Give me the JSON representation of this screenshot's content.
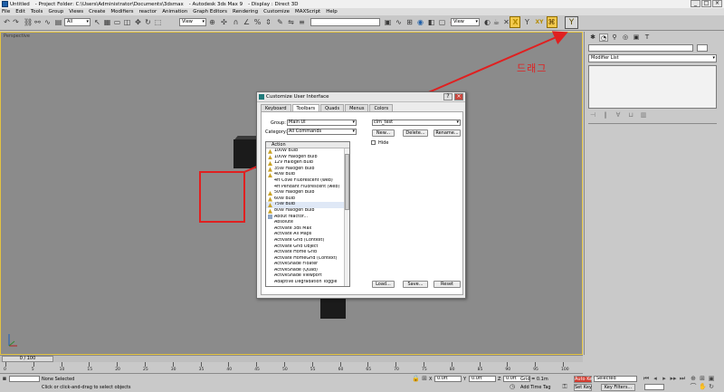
{
  "titlebar": {
    "segments": [
      "Untitled",
      "- Project Folder: C:\\Users\\Administrator\\Documents\\3dsmax",
      "- Autodesk 3ds Max 9",
      "- Display : Direct 3D"
    ],
    "win_buttons": [
      "_",
      "□",
      "×"
    ]
  },
  "menubar": [
    "File",
    "Edit",
    "Tools",
    "Group",
    "Views",
    "Create",
    "Modifiers",
    "reactor",
    "Animation",
    "Graph Editors",
    "Rendering",
    "Customize",
    "MAXScript",
    "Help"
  ],
  "toolbar": {
    "filter": "All",
    "ref_coord_1": "View",
    "ref_coord_2": "View",
    "axis_labels": [
      "X",
      "Y",
      "XY"
    ]
  },
  "viewport": {
    "label": "Perspective"
  },
  "annotation": {
    "label": "드래그",
    "color": "#e02020"
  },
  "cmdpanel": {
    "modifier_list": "Modifier List"
  },
  "dialog": {
    "title": "Customize User Interface",
    "tabs": [
      "Keyboard",
      "Toolbars",
      "Quads",
      "Menus",
      "Colors"
    ],
    "active_tab": "Toolbars",
    "group_label": "Group:",
    "group_value": "Main UI",
    "category_label": "Category:",
    "category_value": "All Commands",
    "toolbar_name": "clm_test",
    "buttons": {
      "new": "New...",
      "delete": "Delete...",
      "rename": "Rename...",
      "load": "Load...",
      "save": "Save...",
      "reset": "Reset"
    },
    "hide_label": "Hide",
    "list_header": "Action",
    "actions": [
      {
        "label": "100W Bulb",
        "icon": "bulb"
      },
      {
        "label": "100W Halogen Bulb",
        "icon": "bulb"
      },
      {
        "label": "12V Halogen Bulb",
        "icon": "bulb"
      },
      {
        "label": "35W Halogen Bulb",
        "icon": "bulb"
      },
      {
        "label": "40W Bulb",
        "icon": "bulb"
      },
      {
        "label": "4ft Cove Fluorescent (web)",
        "icon": "none"
      },
      {
        "label": "4ft Pendant Fluorescent (web)",
        "icon": "none"
      },
      {
        "label": "50W Halogen Bulb",
        "icon": "bulb"
      },
      {
        "label": "60W Bulb",
        "icon": "bulb"
      },
      {
        "label": "75W Bulb",
        "icon": "bulb"
      },
      {
        "label": "80W Halogen Bulb",
        "icon": "bulb"
      },
      {
        "label": "About reactor...",
        "icon": "sq"
      },
      {
        "label": "Absolute",
        "icon": "none"
      },
      {
        "label": "Activate 3ds Max",
        "icon": "none"
      },
      {
        "label": "Activate All Maps",
        "icon": "none"
      },
      {
        "label": "Activate Grid (Context)",
        "icon": "none"
      },
      {
        "label": "Activate Grid Object",
        "icon": "none"
      },
      {
        "label": "Activate Home Grid",
        "icon": "none"
      },
      {
        "label": "Activate HomeGrid (Context)",
        "icon": "none"
      },
      {
        "label": "ActiveShade Floater",
        "icon": "none"
      },
      {
        "label": "ActiveShade (Quad)",
        "icon": "none"
      },
      {
        "label": "ActiveShade Viewport",
        "icon": "none"
      },
      {
        "label": "Adaptive Degradation Toggle",
        "icon": "none"
      }
    ],
    "selected_index": 9
  },
  "timeline": {
    "frame_readout": "0 / 100",
    "ticks": [
      "0",
      "5",
      "10",
      "15",
      "20",
      "25",
      "30",
      "35",
      "40",
      "45",
      "50",
      "55",
      "60",
      "65",
      "70",
      "75",
      "80",
      "85",
      "90",
      "95",
      "100"
    ]
  },
  "status": {
    "selection": "None Selected",
    "prompt": "Click or click-and-drag to select objects",
    "x_value": "0.0ft",
    "y_value": "0.0ft",
    "z_value": "0.0ft",
    "grid": "Grid = 0.1m",
    "add_time_tag": "Add Time Tag",
    "auto_key": "Auto Key",
    "auto_key_value": "Selected",
    "set_key": "Set Key",
    "key_filters": "Key Filters..."
  }
}
